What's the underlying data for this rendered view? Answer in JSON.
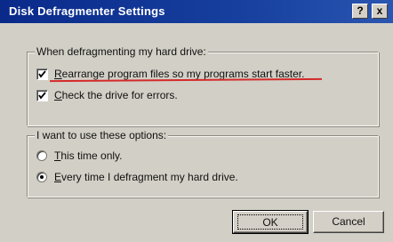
{
  "window": {
    "title": "Disk Defragmenter Settings",
    "help_label": "?",
    "close_label": "x"
  },
  "defrag_group": {
    "legend": "When defragmenting my hard drive:",
    "options": [
      {
        "label_accel": "R",
        "label_rest": "earrange program files so my programs start faster.",
        "checked": true
      },
      {
        "label_accel": "C",
        "label_rest": "heck the drive for errors.",
        "checked": true
      }
    ]
  },
  "usage_group": {
    "legend": "I want to use these options:",
    "options": [
      {
        "label_accel": "T",
        "label_rest": "his time only.",
        "selected": false
      },
      {
        "label_accel": "E",
        "label_rest": "very time I defragment my hard drive.",
        "selected": true
      }
    ]
  },
  "buttons": {
    "ok": "OK",
    "cancel": "Cancel"
  },
  "colors": {
    "titlebar": "#0a2a8a",
    "annotation_underline": "#d42a2a"
  }
}
